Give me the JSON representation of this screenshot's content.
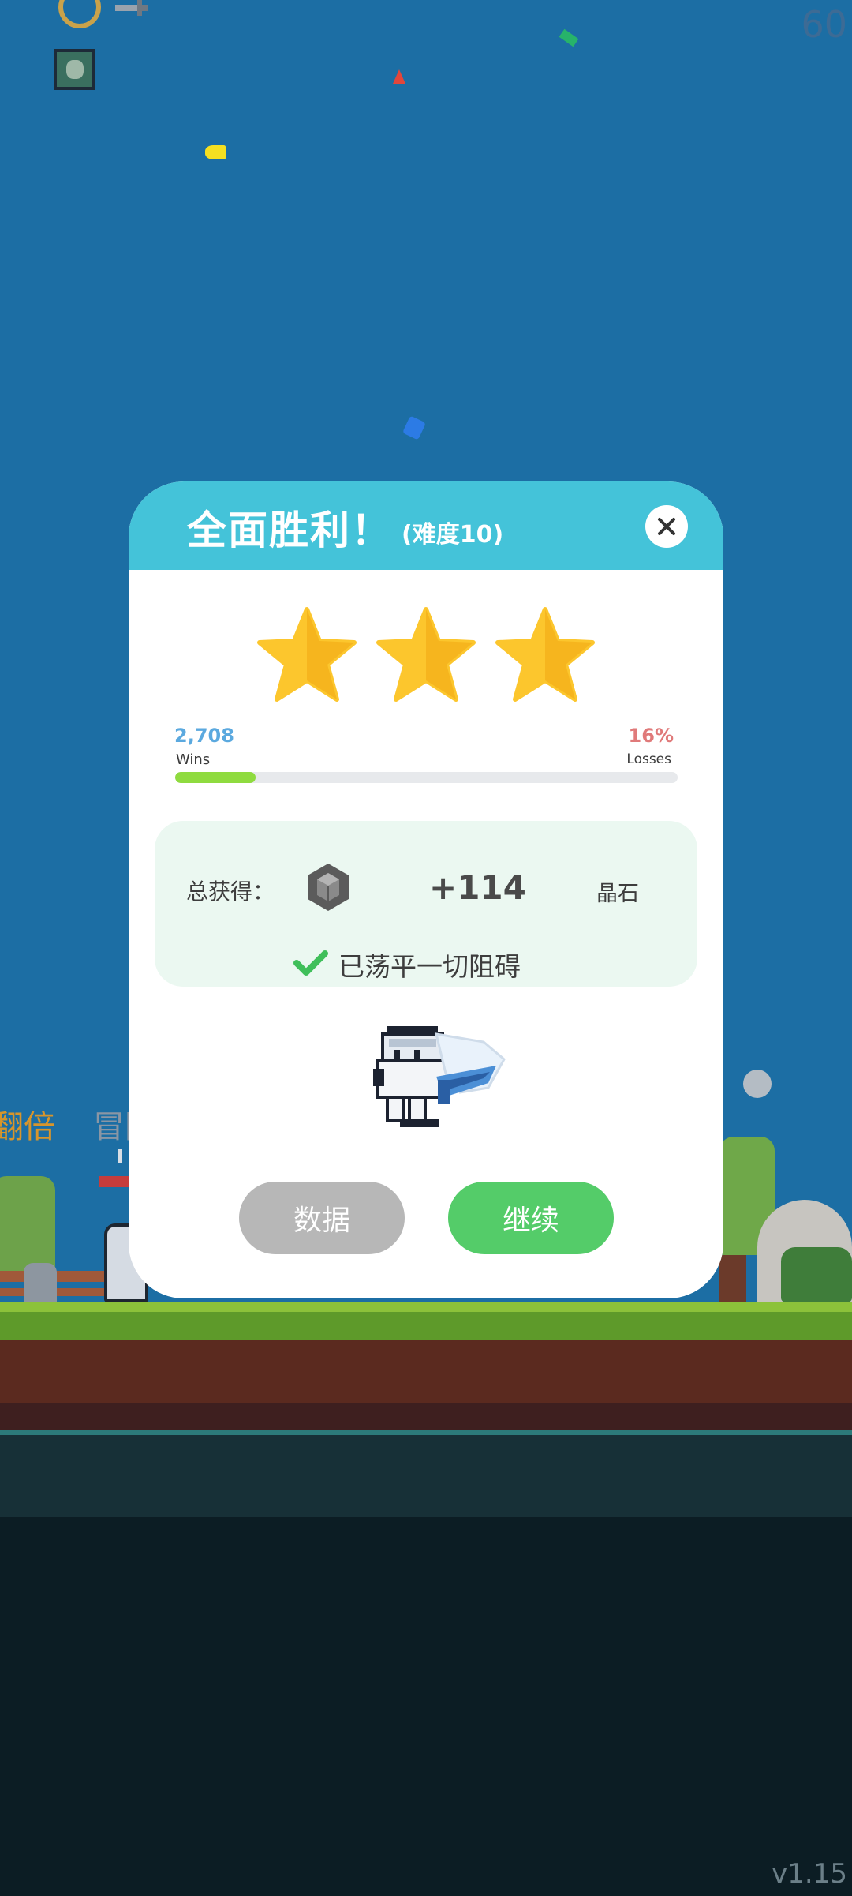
{
  "hud": {
    "fps": "60",
    "version": "v1.15",
    "icons": [
      "ring-icon",
      "sword-icon",
      "portrait-item-icon"
    ]
  },
  "background": {
    "label_orange": "翻倍",
    "label_grey": "冒险"
  },
  "modal": {
    "title": "全面胜利！",
    "difficulty": "(难度10)",
    "stars": 3,
    "stats": {
      "wins_value": "2,708",
      "wins_label": "Wins",
      "losses_value": "16%",
      "losses_label": "Losses",
      "progress_fraction": 0.16
    },
    "reward": {
      "label": "总获得：",
      "icon": "crystal-gem-icon",
      "value": "+114",
      "unit": "晶石",
      "status_icon": "check-icon",
      "status_text": "已荡平一切阻碍"
    },
    "buttons": {
      "stats": "数据",
      "continue": "继续"
    }
  },
  "colors": {
    "header": "#44c3d9",
    "star": "#fcc62d",
    "progress": "#8fdb3f",
    "continue_button": "#54cc69",
    "stats_button": "#b7b7b7",
    "wins": "#5ba9df",
    "losses": "#e07a7a"
  }
}
